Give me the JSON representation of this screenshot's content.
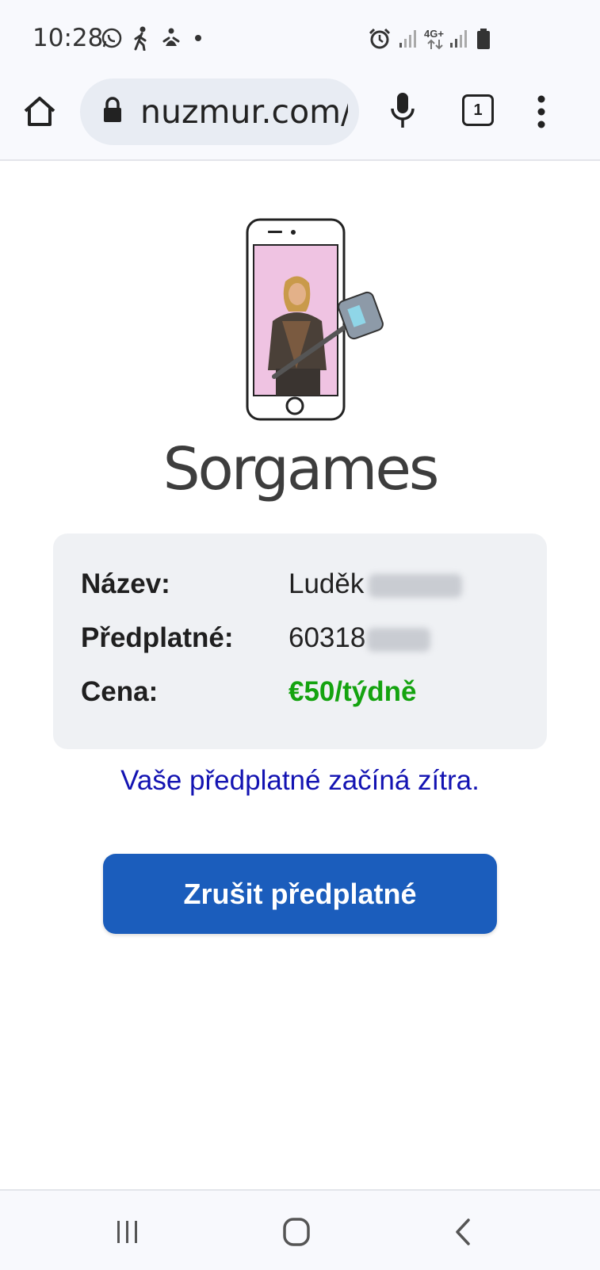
{
  "status_bar": {
    "time": "10:28",
    "network_label": "4G+",
    "icons": [
      "whatsapp-icon",
      "walking-icon",
      "activity-icon",
      "dot-icon",
      "alarm-icon",
      "signal-icon",
      "data-arrows-icon",
      "signal-icon",
      "battery-icon"
    ]
  },
  "browser": {
    "url": "nuzmur.com/",
    "tab_count": "1",
    "icons": [
      "home-icon",
      "lock-icon",
      "mic-icon",
      "tabs-icon",
      "more-vert-icon"
    ]
  },
  "page": {
    "brand": "Sorgames",
    "info": {
      "name_label": "Název:",
      "name_value": "Luděk",
      "subscription_label": "Předplatné:",
      "subscription_value": "60318",
      "price_label": "Cena:",
      "price_value": "€50/týdně"
    },
    "notice": "Vaše předplatné začíná zítra.",
    "cancel_button": "Zrušit předplatné"
  },
  "colors": {
    "accent_button": "#1b5dbc",
    "notice_text": "#1313b2",
    "price_text": "#14a30f",
    "card_bg": "#eff1f4"
  },
  "nav_bar": {
    "icons": [
      "recent-apps-icon",
      "home-circle-icon",
      "back-icon"
    ]
  }
}
